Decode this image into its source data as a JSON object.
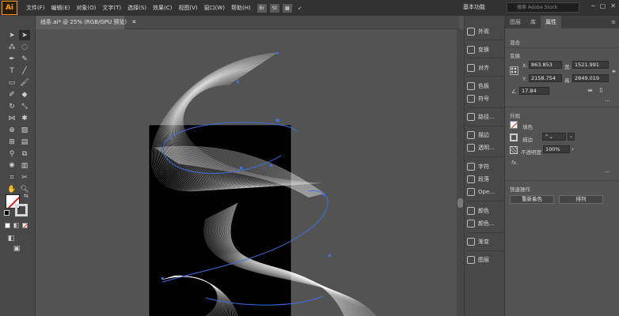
{
  "app": {
    "logo": "Ai"
  },
  "menu": [
    "文件(F)",
    "编辑(E)",
    "对象(O)",
    "文字(T)",
    "选择(S)",
    "效果(C)",
    "视图(V)",
    "窗口(W)",
    "帮助(H)"
  ],
  "menubar_icons": [
    "Br",
    "St"
  ],
  "workspace": "基本功能",
  "search_placeholder": "搜索 Adobe Stock",
  "document": {
    "tab_label": "线条.ai* @ 25% (RGB/GPU 预览)"
  },
  "dock": [
    "外观",
    "变换",
    "对齐",
    "色板",
    "符号",
    "路径...",
    "描边",
    "透明...",
    "字符",
    "段落",
    "Ope...",
    "颜色",
    "颜色...",
    "渐变",
    "图层"
  ],
  "properties": {
    "tabs": [
      "图层",
      "库",
      "属性"
    ],
    "active_tab": "属性",
    "no_selection": "混合",
    "transform": {
      "title": "变换",
      "x_label": "X:",
      "x": "863.853",
      "y_label": "Y:",
      "y": "2158.754",
      "w_label": "宽:",
      "w": "1521.991",
      "h_label": "高:",
      "h": "2849.019",
      "angle": "17.84"
    },
    "appearance": {
      "title": "外观",
      "fill_label": "填色",
      "stroke_label": "描边",
      "opacity_label": "不透明度",
      "opacity": "100%",
      "fx": "fx."
    },
    "quick_actions": {
      "title": "快速操作",
      "recolor": "重新着色",
      "arrange": "排列"
    }
  },
  "colors": {
    "accent": "#ff9a00",
    "selection": "#3f6ee0",
    "artboard": "#000000",
    "canvas": "#535353",
    "fill_swatch": "#ffffff",
    "none_slash": "#e02020"
  }
}
